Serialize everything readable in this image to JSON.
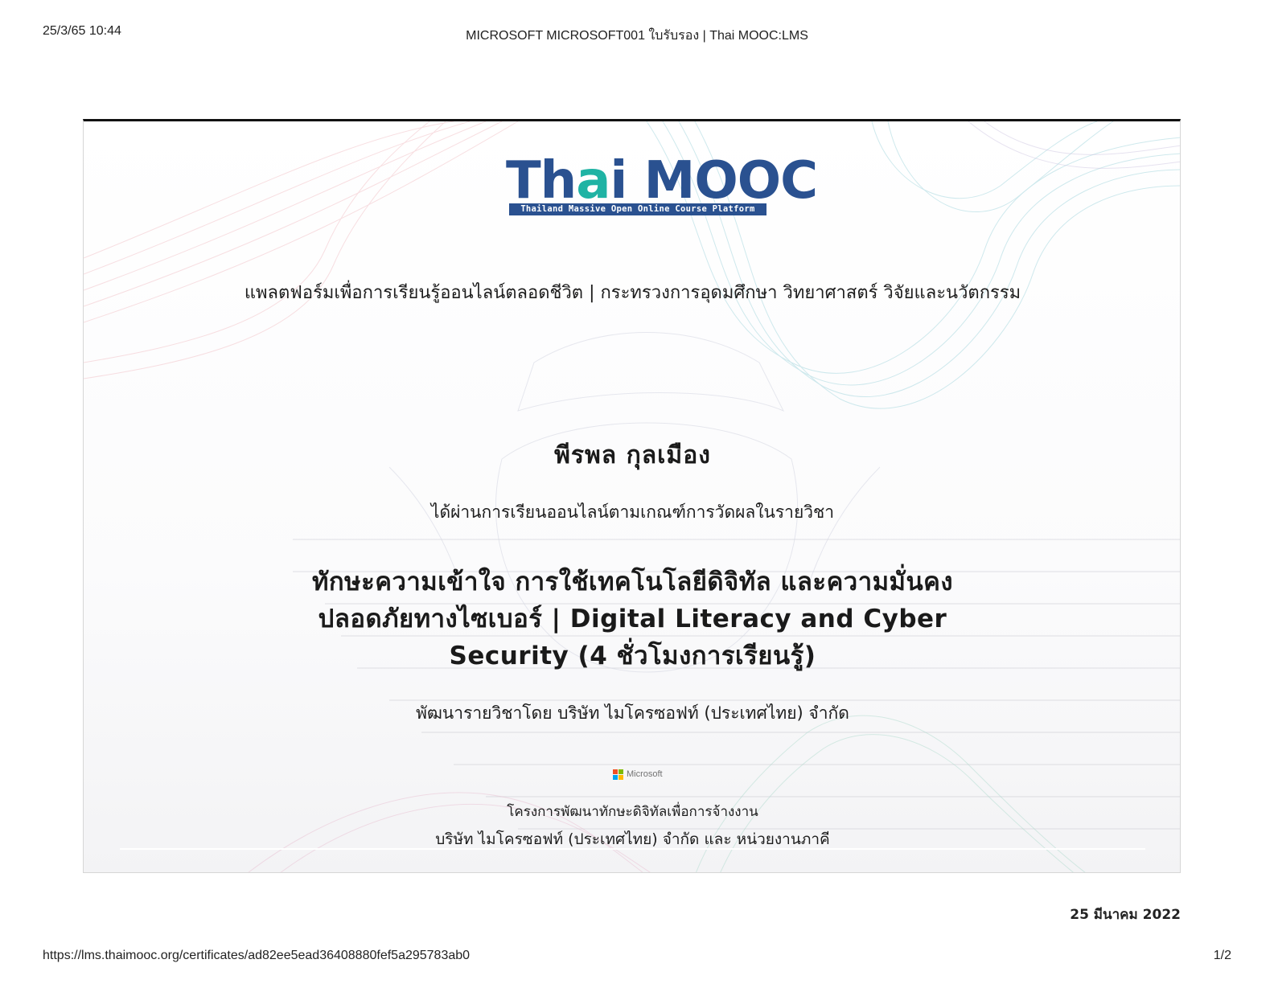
{
  "print_header": {
    "datetime": "25/3/65 10:44",
    "title": "MICROSOFT MICROSOFT001 ใบรับรอง | Thai MOOC:LMS"
  },
  "certificate": {
    "logo": {
      "text_a": "Th",
      "text_accent": "a",
      "text_b": "i MOOC",
      "subtitle": "Thailand Massive Open Online Course Platform",
      "colors": {
        "primary": "#2a5190",
        "accent": "#1fb3a4"
      }
    },
    "platform_line": "แพลตฟอร์มเพื่อการเรียนรู้ออนไลน์ตลอดชีวิต | กระทรวงการอุดมศึกษา วิทยาศาสตร์ วิจัยและนวัตกรรม",
    "recipient_name": "พีรพล กุลเมือง",
    "passed_text": "ได้ผ่านการเรียนออนไลน์ตามเกณฑ์การวัดผลในรายวิชา",
    "course_title": "ทักษะความเข้าใจ การใช้เทคโนโลยีดิจิทัล และความมั่นคงปลอดภัยทางไซเบอร์ | Digital Literacy and Cyber Security (4 ชั่วโมงการเรียนรู้)",
    "developer": "พัฒนารายวิชาโดย บริษัท ไมโครซอฟท์ (ประเทศไทย) จำกัด",
    "partner_logo": {
      "word": "Microsoft",
      "colors": [
        "#f25022",
        "#7fba00",
        "#00a4ef",
        "#ffb900"
      ]
    },
    "project_line": "โครงการพัฒนาทักษะดิจิทัลเพื่อการจ้างงาน",
    "partner_line": "บริษัท ไมโครซอฟท์ (ประเทศไทย) จำกัด และ หน่วยงานภาคี"
  },
  "issue_date": "25 มีนาคม 2022",
  "print_footer": {
    "url": "https://lms.thaimooc.org/certificates/ad82ee5ead36408880fef5a295783ab0",
    "page": "1/2"
  }
}
